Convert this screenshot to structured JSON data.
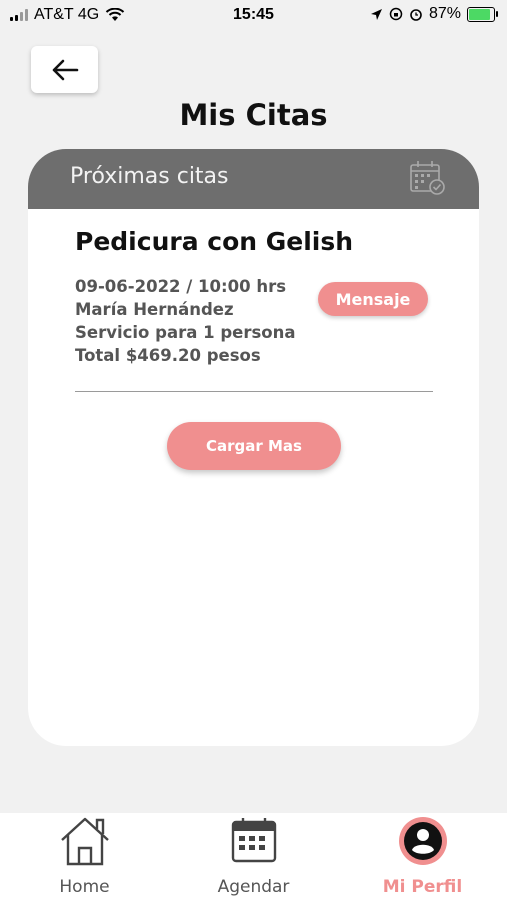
{
  "status_bar": {
    "carrier": "AT&T 4G",
    "time": "15:45",
    "battery_percent": "87%",
    "battery_level": 0.87
  },
  "header": {
    "back_icon": "arrow-left-icon",
    "title": "Mis Citas"
  },
  "card": {
    "header_label": "Próximas citas",
    "header_icon": "calendar-check-icon",
    "appointment": {
      "title": "Pedicura con Gelish",
      "datetime": "09-06-2022 / 10:00 hrs",
      "client": "María Hernández",
      "service": "Servicio para 1 persona",
      "total": "Total $469.20 pesos",
      "message_button": "Mensaje"
    },
    "load_more_button": "Cargar Mas"
  },
  "bottom_nav": {
    "items": [
      {
        "label": "Home",
        "icon": "home-icon"
      },
      {
        "label": "Agendar",
        "icon": "calendar-icon"
      },
      {
        "label": "Mi Perfil",
        "icon": "profile-icon"
      }
    ],
    "active_index": 2
  },
  "colors": {
    "accent": "#f08f8f",
    "card_header": "#6e6e6e",
    "background": "#f1f1f1"
  }
}
